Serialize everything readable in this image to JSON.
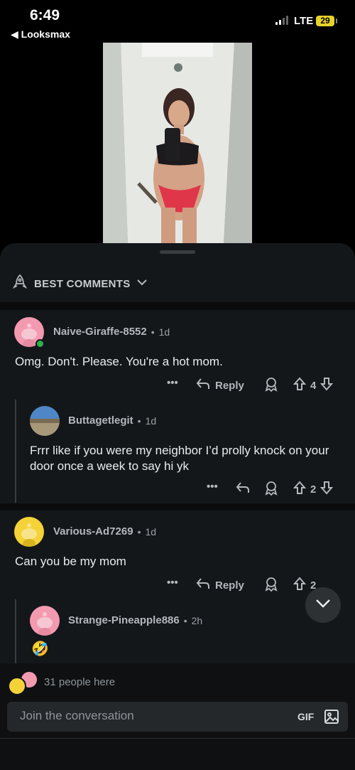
{
  "status_bar": {
    "time": "6:49",
    "back_app": "◀ Looksmax",
    "network": "LTE",
    "battery": "29"
  },
  "post": {
    "image_alt": "mirror-selfie-photo"
  },
  "sort": {
    "label": "BEST COMMENTS",
    "icon": "rocket-icon"
  },
  "comments": [
    {
      "username": "Naive-Giraffe-8552",
      "age": "1d",
      "body": "Omg. Don't. Please. You're a hot mom.",
      "reply_label": "Reply",
      "votes": "4",
      "more": "•••"
    },
    {
      "username": "Buttagetlegit",
      "age": "1d",
      "body": "Frrr like if you were my neighbor I’d prolly knock on your door once a week to say hi yk",
      "votes": "2",
      "more": "•••"
    },
    {
      "username": "Various-Ad7269",
      "age": "1d",
      "body": "Can you be my mom",
      "reply_label": "Reply",
      "votes": "2",
      "more": "•••"
    },
    {
      "username": "Strange-Pineapple886",
      "age": "2h",
      "body": "🤣"
    }
  ],
  "presence": {
    "text": "31 people here"
  },
  "composer": {
    "placeholder": "Join the conversation",
    "gif_label": "GIF"
  },
  "colors": {
    "sheet_bg": "#14171a",
    "avatar_pink": "#f49ab0",
    "avatar_yellow": "#f5d238",
    "online": "#2bb34a"
  }
}
